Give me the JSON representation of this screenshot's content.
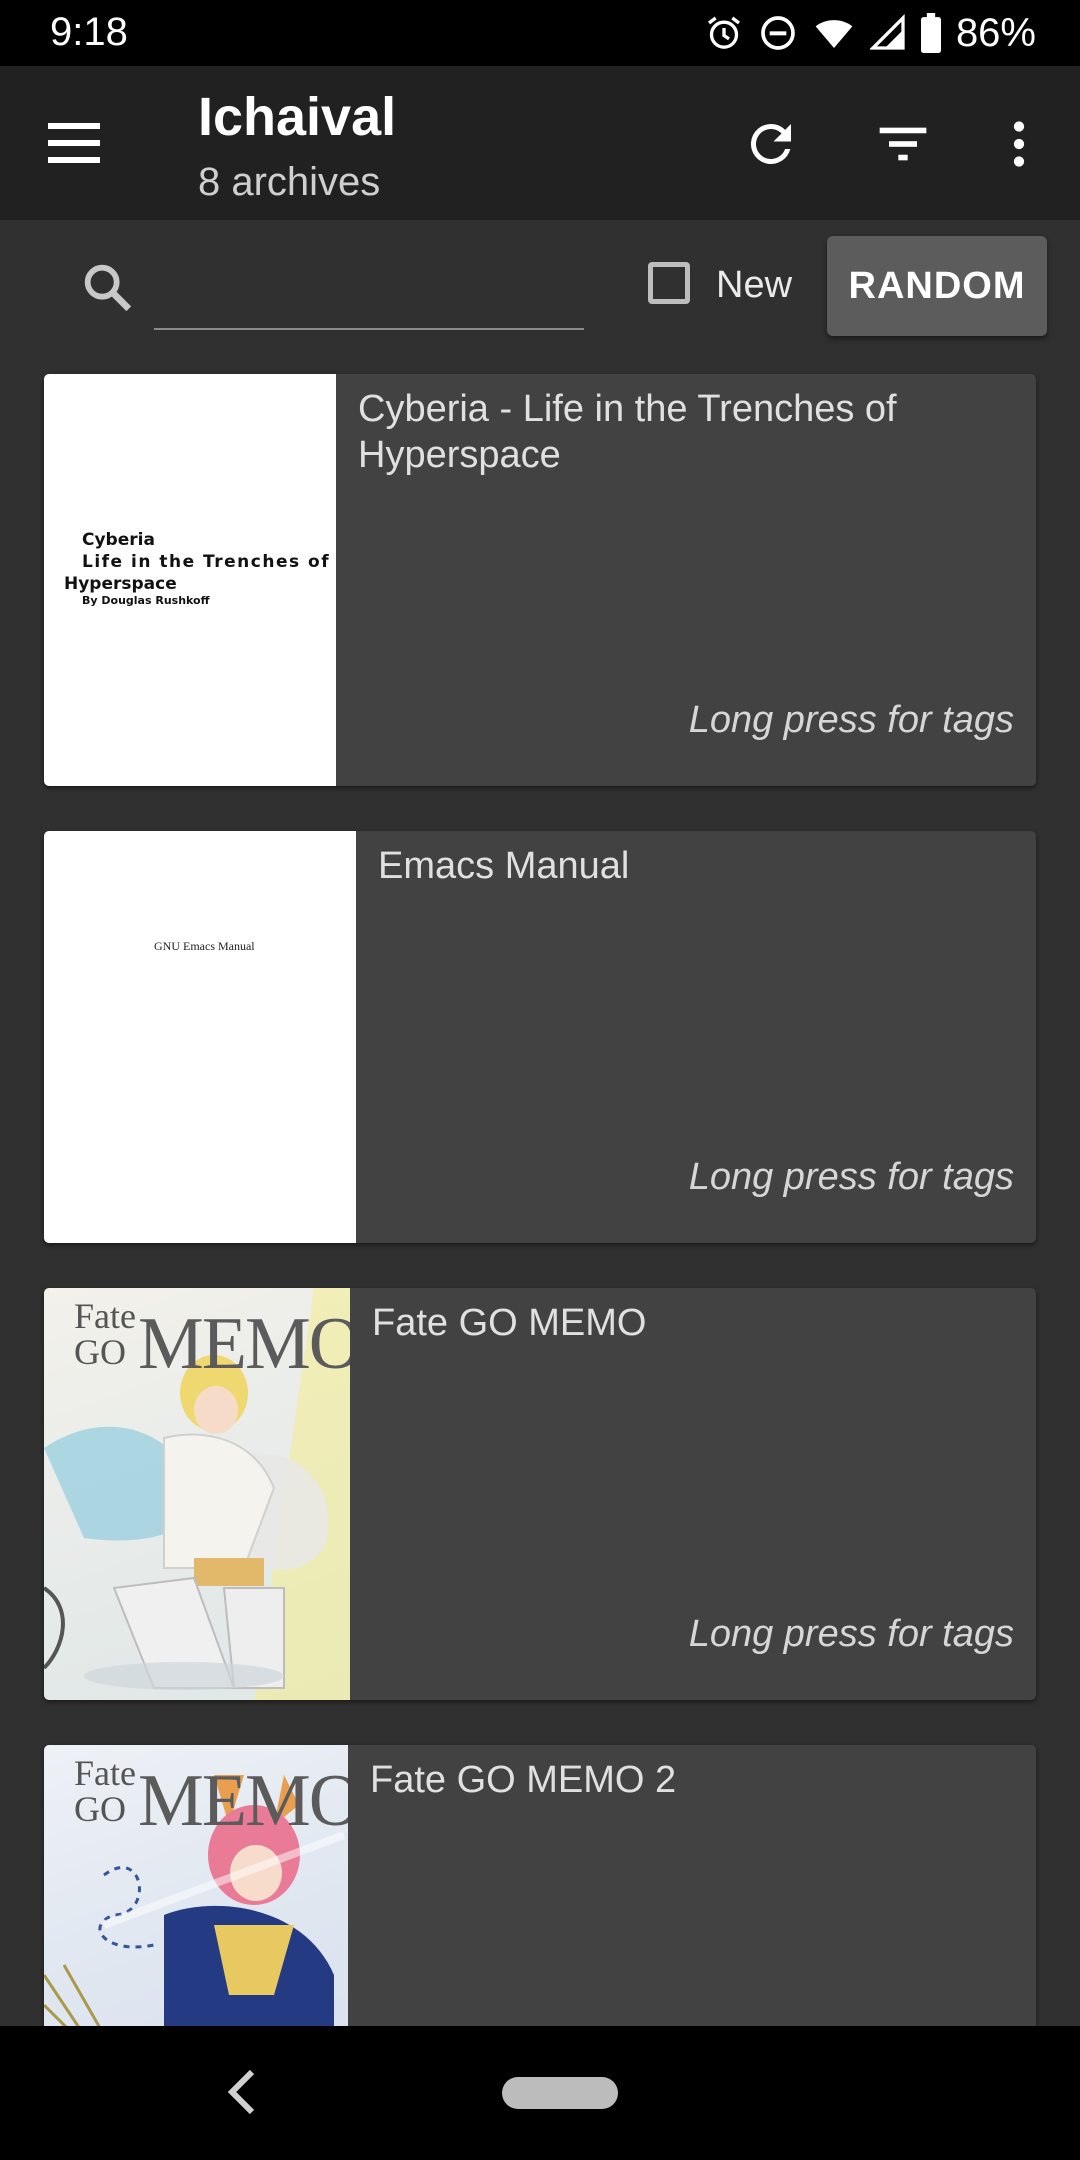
{
  "status_bar": {
    "time": "9:18",
    "battery": "86%"
  },
  "app_bar": {
    "title": "Ichaival",
    "subtitle": "8 archives"
  },
  "search": {
    "value": "",
    "placeholder": "",
    "new_label": "New",
    "random_label": "RANDOM"
  },
  "archives": [
    {
      "title": "Cyberia - Life in the Trenches of Hyperspace",
      "hint": "Long press for tags",
      "cover_lines": [
        "Cyberia",
        "Life in the Trenches of",
        "Hyperspace",
        "By Douglas Rushkoff"
      ]
    },
    {
      "title": "Emacs Manual",
      "hint": "Long press for tags",
      "cover_text": "GNU Emacs Manual"
    },
    {
      "title": "Fate GO MEMO",
      "hint": "Long press for tags",
      "cover_logo": [
        "Fate",
        "GO",
        "MEMO"
      ]
    },
    {
      "title": "Fate GO MEMO 2",
      "hint": "",
      "cover_logo": [
        "Fate",
        "GO",
        "MEMO"
      ]
    }
  ],
  "icons": [
    "menu-icon",
    "refresh-icon",
    "filter-icon",
    "more-vert-icon",
    "search-icon",
    "alarm-icon",
    "dnd-icon",
    "wifi-icon",
    "signal-icon",
    "battery-icon",
    "back-icon"
  ],
  "colors": {
    "app_bar": "#212121",
    "background": "#303030",
    "card": "#424242",
    "button": "#5c5c5c"
  }
}
